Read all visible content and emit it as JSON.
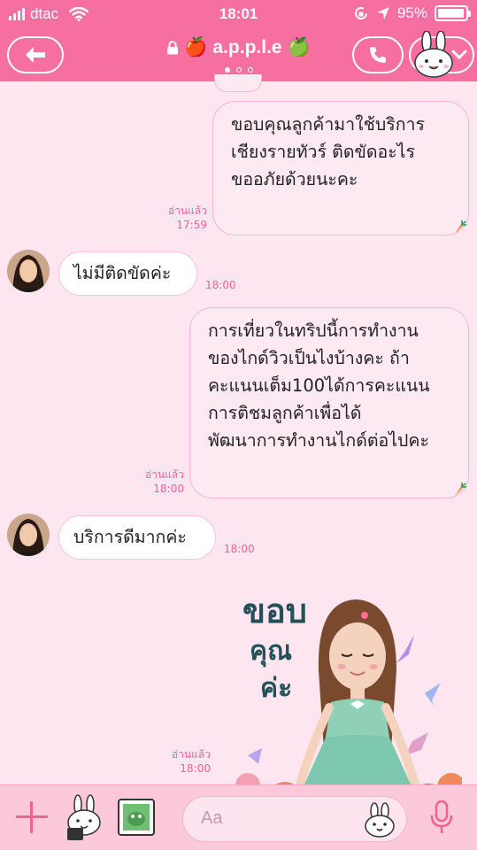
{
  "status_bar": {
    "carrier": "dtac",
    "time": "18:01",
    "battery_text": "95%",
    "battery_level": 0.95
  },
  "header": {
    "title_prefix": "🍎",
    "title": "a.p.p.l.e",
    "title_suffix": "🍏",
    "page_dots": 3,
    "active_dot": 0
  },
  "messages": [
    {
      "side": "out",
      "lines": [
        "ขอบคุณลูกค้ามาใช้บริการ",
        "เชียงรายทัวร์ ติดขัดอะไร",
        "ขออภัยด้วยนะคะ"
      ],
      "read_label": "อ่านแล้ว",
      "time": "17:59"
    },
    {
      "side": "in",
      "lines": [
        "ไม่มีติดขัดค่ะ"
      ],
      "time": "18:00"
    },
    {
      "side": "out",
      "lines": [
        "การเที่ยวในทริปนี้การทำงาน",
        "ของไกด์วิวเป็นไงบ้างคะ ถ้า",
        "คะแนนเต็ม100ได้การคะแนน",
        "การติชมลูกค้าเพื่อได้",
        "พัฒนาการทำงานไกด์ต่อไปคะ"
      ],
      "read_label": "อ่านแล้ว",
      "time": "18:00"
    },
    {
      "side": "in",
      "lines": [
        "บริการดีมากค่ะ"
      ],
      "time": "18:00"
    },
    {
      "side": "out",
      "type": "sticker",
      "sticker_text": [
        "ขอบ",
        "คุณ",
        "ค่ะ"
      ],
      "read_label": "อ่านแล้ว",
      "time": "18:00"
    }
  ],
  "composer": {
    "placeholder": "Aa"
  },
  "colors": {
    "accent": "#f76fa0",
    "bubble_border": "#f7b8cd",
    "time_text": "#f06292",
    "background": "#fde6ef"
  },
  "icons": [
    "signal-icon",
    "wifi-icon",
    "lock-rotation-icon",
    "location-icon",
    "battery-icon",
    "back-arrow-icon",
    "lock-icon",
    "phone-icon",
    "chevron-down-icon",
    "plus-icon",
    "sticker-icon",
    "photo-icon",
    "emoji-icon",
    "mic-icon"
  ]
}
